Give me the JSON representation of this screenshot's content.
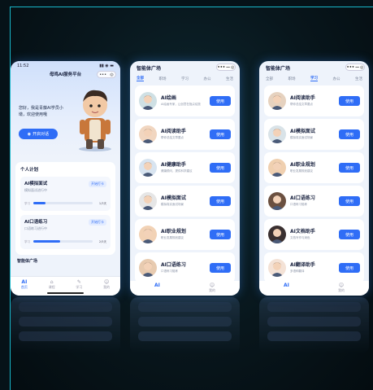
{
  "phone1": {
    "status_time": "11:52",
    "status_icons": "▮▮ ◉ ▬",
    "title": "母鸡AI服务平台",
    "greeting": "您好，我是青藤AI学员小墩，欢迎使用哦",
    "greet_button": "开启对话",
    "plan_title": "个人计划",
    "plans": [
      {
        "name": "AI模拟面试",
        "sub": "模拟面试进行中",
        "tag": "开始打卡",
        "left": "学习",
        "right": "1/3天",
        "progress": 0.2
      },
      {
        "name": "AI口语练习",
        "sub": "口语练习进行中",
        "tag": "开始打卡",
        "left": "学习",
        "right": "2/5天",
        "progress": 0.45
      }
    ],
    "plaza_label": "智能体广场",
    "tabs": [
      {
        "label": "首页",
        "icon": "AI",
        "active": true
      },
      {
        "label": "课程",
        "icon": "⌂",
        "active": false
      },
      {
        "label": "学习",
        "icon": "✎",
        "active": false
      },
      {
        "label": "我的",
        "icon": "☺",
        "active": false
      }
    ]
  },
  "phone2": {
    "title": "智能体广场",
    "categories": [
      "全部",
      "职场",
      "学习",
      "办公",
      "生活"
    ],
    "active_category": 0,
    "agents": [
      {
        "name": "AI绘画",
        "desc": "AI绘画专家，让创意在指尖绽放",
        "button": "使用",
        "avatar_color": "#cfe0e4"
      },
      {
        "name": "AI阅读助手",
        "desc": "帮你总结文章要点",
        "button": "使用",
        "avatar_color": "#f1d6c0"
      },
      {
        "name": "AI健康助手",
        "desc": "健康顾问，提供科学建议",
        "button": "使用",
        "avatar_color": "#d8e4f0"
      },
      {
        "name": "AI模拟面试",
        "desc": "模拟真实面试场景",
        "button": "使用",
        "avatar_color": "#e6e6e6"
      },
      {
        "name": "AI职业规划",
        "desc": "职业发展规划建议",
        "button": "使用",
        "avatar_color": "#f2d2b5"
      },
      {
        "name": "AI口语练习",
        "desc": "口语练习陪练",
        "button": "使用",
        "avatar_color": "#e8cbb0"
      }
    ],
    "tabs": [
      {
        "label": "AI",
        "icon": "AI",
        "active": true
      },
      {
        "label": "我的",
        "icon": "☺",
        "active": false
      }
    ]
  },
  "phone3": {
    "title": "智能体广场",
    "categories": [
      "全部",
      "职场",
      "学习",
      "办公",
      "生活"
    ],
    "active_category": 2,
    "agents": [
      {
        "name": "AI阅读助手",
        "desc": "帮你总结文章要点",
        "button": "使用",
        "avatar_color": "#e6d2bf"
      },
      {
        "name": "AI模拟面试",
        "desc": "模拟真实面试场景",
        "button": "使用",
        "avatar_color": "#d9e3e8"
      },
      {
        "name": "AI职业规划",
        "desc": "职业发展规划建议",
        "button": "使用",
        "avatar_color": "#f0d0b0"
      },
      {
        "name": "AI口语练习",
        "desc": "口语练习陪练",
        "button": "使用",
        "avatar_color": "#6b5040"
      },
      {
        "name": "AI文档助手",
        "desc": "文档写作与润色",
        "button": "使用",
        "avatar_color": "#3a3030"
      },
      {
        "name": "AI翻译助手",
        "desc": "多语种翻译",
        "button": "使用",
        "avatar_color": "#f4e2d6"
      }
    ],
    "tabs": [
      {
        "label": "AI",
        "icon": "AI",
        "active": true
      },
      {
        "label": "我的",
        "icon": "☺",
        "active": false
      }
    ]
  },
  "colors": {
    "accent": "#2f6df6",
    "frame_border": "#18b6c9",
    "background": "#061218"
  }
}
